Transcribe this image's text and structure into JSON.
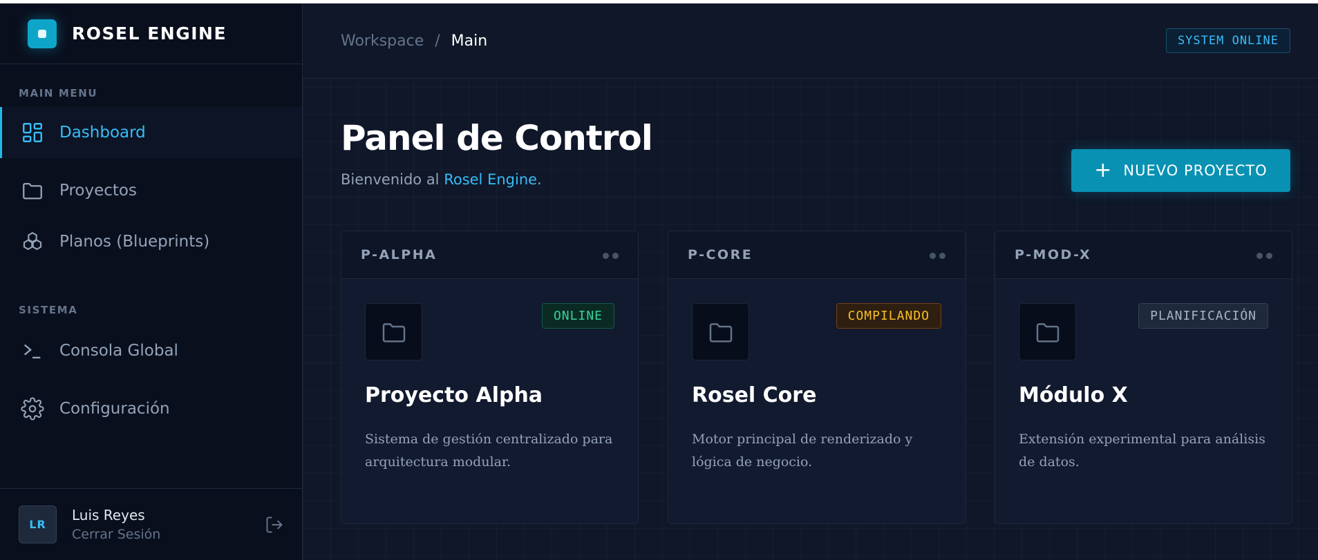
{
  "brand": {
    "name": "ROSEL ENGINE"
  },
  "sidebar": {
    "main_section": "MAIN MENU",
    "system_section": "SISTEMA",
    "items": [
      {
        "label": "Dashboard",
        "icon": "grid-icon"
      },
      {
        "label": "Proyectos",
        "icon": "folder-icon"
      },
      {
        "label": "Planos (Blueprints)",
        "icon": "blueprint-icon"
      },
      {
        "label": "Consola Global",
        "icon": "terminal-icon"
      },
      {
        "label": "Configuración",
        "icon": "gear-icon"
      }
    ]
  },
  "user": {
    "initials": "LR",
    "name": "Luis Reyes",
    "logout_label": "Cerrar Sesión"
  },
  "header": {
    "crumb_1": "Workspace",
    "separator": "/",
    "crumb_2": "Main",
    "status": "SYSTEM ONLINE"
  },
  "page": {
    "title": "Panel de Control",
    "subtitle_prefix": "Bienvenido al ",
    "subtitle_highlight": "Rosel Engine",
    "subtitle_suffix": ".",
    "new_button": "NUEVO PROYECTO"
  },
  "projects": [
    {
      "code": "P-ALPHA",
      "status": "ONLINE",
      "title": "Proyecto Alpha",
      "desc": "Sistema de gestión centralizado para arquitectura modular.",
      "status_color": "#34d399",
      "status_bg": "#0b2a24",
      "status_border": "#145c44"
    },
    {
      "code": "P-CORE",
      "status": "COMPILANDO",
      "title": "Rosel Core",
      "desc": "Motor principal de renderizado y lógica de negocio.",
      "status_color": "#fbbf24",
      "status_bg": "#2e1f10",
      "status_border": "#7a3e12"
    },
    {
      "code": "P-MOD-X",
      "status": "PLANIFICACIÓN",
      "title": "Módulo X",
      "desc": "Extensión experimental para análisis de datos.",
      "status_color": "#a8b4c7",
      "status_bg": "#1e293b",
      "status_border": "#334155"
    }
  ],
  "colors": {
    "accent": "#0891b2",
    "accent_text": "#38bdf8",
    "background": "#0f1729",
    "sidebar": "#0a0f1d"
  }
}
